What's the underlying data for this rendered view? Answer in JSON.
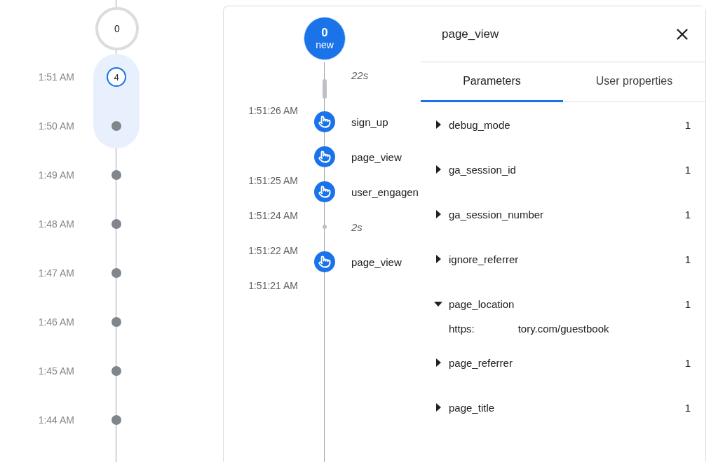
{
  "minutes_counter": {
    "count": "0"
  },
  "minutes": [
    {
      "time": "1:51 AM",
      "count": "4",
      "selected": true
    },
    {
      "time": "1:50 AM",
      "selected": false
    },
    {
      "time": "1:49 AM",
      "selected": false
    },
    {
      "time": "1:48 AM",
      "selected": false
    },
    {
      "time": "1:47 AM",
      "selected": false
    },
    {
      "time": "1:46 AM",
      "selected": false
    },
    {
      "time": "1:45 AM",
      "selected": false
    },
    {
      "time": "1:44 AM",
      "selected": false
    }
  ],
  "stream": {
    "counter": {
      "count": "0",
      "label": "new"
    },
    "timestamps": [
      "1:51:26 AM",
      "1:51:25 AM",
      "1:51:24 AM",
      "1:51:22 AM",
      "1:51:21 AM"
    ],
    "items": [
      {
        "kind": "gap",
        "label": "22s"
      },
      {
        "kind": "event",
        "label": "sign_up"
      },
      {
        "kind": "event",
        "label": "page_view"
      },
      {
        "kind": "event",
        "label": "user_engagen"
      },
      {
        "kind": "gap-small",
        "label": "2s"
      },
      {
        "kind": "event",
        "label": "page_view"
      }
    ]
  },
  "detail": {
    "title": "page_view",
    "tabs": [
      {
        "label": "Parameters",
        "selected": true
      },
      {
        "label": "User properties",
        "selected": false
      }
    ],
    "parameters": [
      {
        "name": "debug_mode",
        "count": "1",
        "expanded": false
      },
      {
        "name": "ga_session_id",
        "count": "1",
        "expanded": false
      },
      {
        "name": "ga_session_number",
        "count": "1",
        "expanded": false
      },
      {
        "name": "ignore_referrer",
        "count": "1",
        "expanded": false
      },
      {
        "name": "page_location",
        "count": "1",
        "expanded": true,
        "value_parts": [
          "https:",
          "tory.com/guestbook"
        ]
      },
      {
        "name": "page_referrer",
        "count": "1",
        "expanded": false
      },
      {
        "name": "page_title",
        "count": "1",
        "expanded": false
      }
    ]
  }
}
